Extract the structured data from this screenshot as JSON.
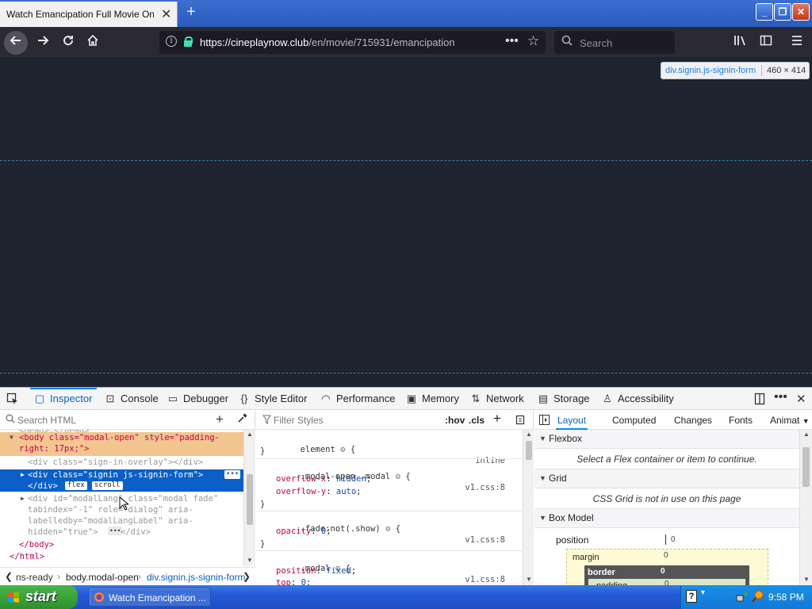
{
  "browser": {
    "tab_title": "Watch Emancipation Full Movie Online F",
    "tab_close": "✕",
    "new_tab": "+",
    "window_buttons": {
      "minimize": "_",
      "restore": "❐",
      "close": "✕"
    },
    "url_host": "https://cineplaynow.club",
    "url_path": "/en/movie/715931/emancipation",
    "url_more": "•••",
    "bookmark_star": "☆",
    "search_placeholder": "Search"
  },
  "highlighter": {
    "selector": "div.signin.js-signin-form",
    "dimensions": "460 × 414"
  },
  "devtools": {
    "tabs": [
      {
        "label": "Inspector",
        "icon": "inspector-icon"
      },
      {
        "label": "Console",
        "icon": "console-icon"
      },
      {
        "label": "Debugger",
        "icon": "debugger-icon"
      },
      {
        "label": "Style Editor",
        "icon": "style-editor-icon"
      },
      {
        "label": "Performance",
        "icon": "performance-icon"
      },
      {
        "label": "Memory",
        "icon": "memory-icon"
      },
      {
        "label": "Network",
        "icon": "network-icon"
      },
      {
        "label": "Storage",
        "icon": "storage-icon"
      },
      {
        "label": "Accessibility",
        "icon": "accessibility-icon"
      }
    ],
    "markup": {
      "search_placeholder": "Search HTML",
      "lines": {
        "head": "<head>…</head>",
        "body1": "<body class=\"modal-open\" style=\"padding-",
        "body2": "right: 17px;\">",
        "overlay": "<div class=\"sign-in-overlay\"></div>",
        "signin": "<div class=\"signin js-signin-form\">",
        "closediv": "</div>",
        "badge_flex": "flex",
        "badge_scroll": "scroll",
        "modal1": "<div id=\"modalLang\" class=\"modal fade\"",
        "modal2": "tabindex=\"-1\" role=\"dialog\" aria-",
        "modal3": "labelledby=\"modalLangLabel\" aria-",
        "modal4": "hidden=\"true\">",
        "modal4b": "</div>",
        "body_close": "</body>",
        "html_close": "</html>"
      },
      "breadcrumbs": [
        "ns-ready",
        "body.modal-open",
        "div.signin.js-signin-form"
      ]
    },
    "rules": {
      "filter_placeholder": "Filter Styles",
      "hov": ":hov",
      "cls": ".cls",
      "blocks": {
        "element_selector": "element",
        "element_source": "inline",
        "modal_open_selector": ".modal-open .modal",
        "modal_open_source": "v1.css:8",
        "overflow_x_prop": "overflow-x",
        "overflow_x_val": "hidden",
        "overflow_y_prop": "overflow-y",
        "overflow_y_val": "auto",
        "fade_selector": ".fade:not(.show)",
        "fade_source": "v1.css:8",
        "opacity_prop": "opacity",
        "opacity_val": "0",
        "modal_selector": ".modal",
        "modal_source": "v1.css:8",
        "position_prop": "position",
        "position_val": "fixed",
        "top_prop": "top",
        "top_val": "0"
      }
    },
    "layout": {
      "subtabs": [
        "Layout",
        "Computed",
        "Changes",
        "Fonts",
        "Animat"
      ],
      "flexbox_title": "Flexbox",
      "flexbox_note": "Select a Flex container or item to continue.",
      "grid_title": "Grid",
      "grid_note": "CSS Grid is not in use on this page",
      "boxmodel_title": "Box Model",
      "bm_position": "position",
      "bm_position_val": "0",
      "bm_margin": "margin",
      "bm_margin_val": "0",
      "bm_border": "border",
      "bm_border_val": "0",
      "bm_padding": "padding",
      "bm_padding_val": "0"
    }
  },
  "taskbar": {
    "start_label": "start",
    "task_label": "Watch Emancipation ...",
    "clock": "9:58 PM"
  },
  "colors": {
    "page_bg": "#1e2430",
    "devtools_accent": "#0a84ff",
    "xp_blue": "#2459d6",
    "start_green": "#3a9d3a"
  }
}
